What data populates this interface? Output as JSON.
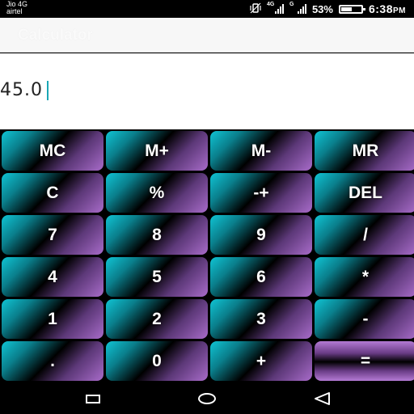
{
  "status_bar": {
    "carrier_1": "Jio 4G",
    "carrier_2": "airtel",
    "signal_1_tag": "4G",
    "signal_2_tag": "G",
    "battery_percent": "53%",
    "battery_level": 0.53,
    "time": "6:38",
    "ampm": "PM"
  },
  "app_bar": {
    "title": "Calculator"
  },
  "display": {
    "value": "45.0"
  },
  "keypad": {
    "rows": [
      [
        "MC",
        "M+",
        "M-",
        "MR"
      ],
      [
        "C",
        "%",
        "-+",
        "DEL"
      ],
      [
        "7",
        "8",
        "9",
        "/"
      ],
      [
        "4",
        "5",
        "6",
        "*"
      ],
      [
        "1",
        "2",
        "3",
        "-"
      ],
      [
        ".",
        "0",
        "+",
        "="
      ]
    ]
  },
  "colors": {
    "key_cyan": "#10c4d4",
    "key_purple": "#a86bc9",
    "cursor": "#1aa7b5"
  },
  "icons": {
    "recents": "square-icon",
    "home": "circle-icon",
    "back": "triangle-back-icon"
  }
}
